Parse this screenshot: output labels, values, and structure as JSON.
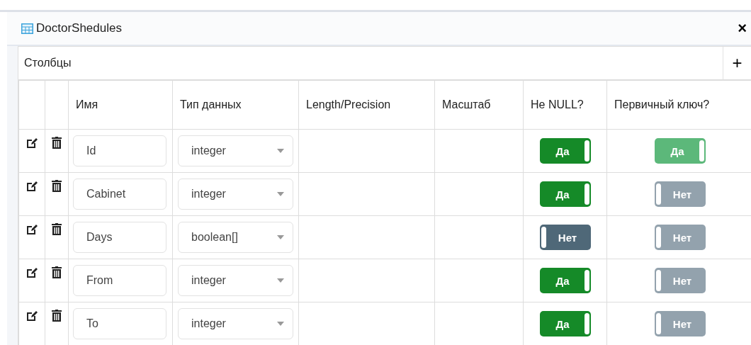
{
  "window": {
    "title": "DoctorShedules",
    "close": "×"
  },
  "panel": {
    "title": "Столбцы",
    "add": "+"
  },
  "table": {
    "columns": [
      "Имя",
      "Тип данных",
      "Length/Precision",
      "Масштаб",
      "Не NULL?",
      "Первичный ключ?"
    ],
    "rows": [
      {
        "name": "Id",
        "type": "integer",
        "not_null": {
          "label": "Да",
          "on": true,
          "disabled": false
        },
        "primary_key": {
          "label": "Да",
          "on": true,
          "disabled": true
        }
      },
      {
        "name": "Cabinet",
        "type": "integer",
        "not_null": {
          "label": "Да",
          "on": true,
          "disabled": false
        },
        "primary_key": {
          "label": "Нет",
          "on": false,
          "disabled": true
        }
      },
      {
        "name": "Days",
        "type": "boolean[]",
        "not_null": {
          "label": "Нет",
          "on": false,
          "disabled": false
        },
        "primary_key": {
          "label": "Нет",
          "on": false,
          "disabled": true
        }
      },
      {
        "name": "From",
        "type": "integer",
        "not_null": {
          "label": "Да",
          "on": true,
          "disabled": false
        },
        "primary_key": {
          "label": "Нет",
          "on": false,
          "disabled": true
        }
      },
      {
        "name": "To",
        "type": "integer",
        "not_null": {
          "label": "Да",
          "on": true,
          "disabled": false
        },
        "primary_key": {
          "label": "Нет",
          "on": false,
          "disabled": true
        }
      }
    ]
  }
}
